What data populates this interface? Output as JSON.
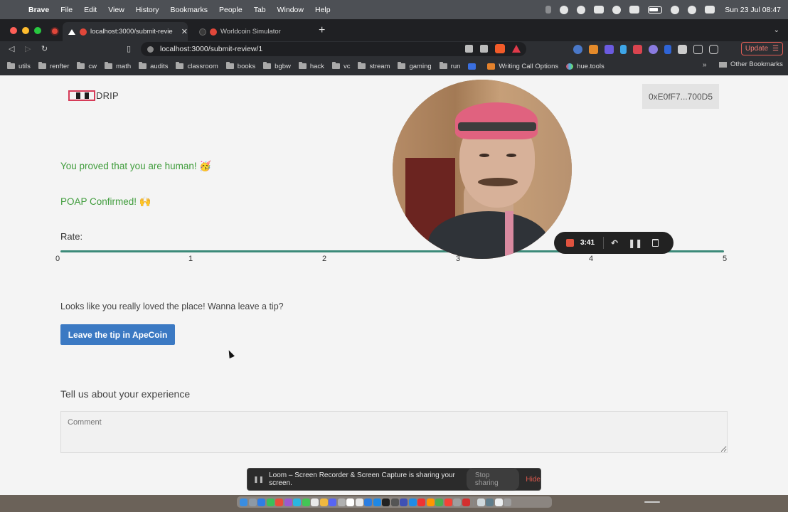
{
  "menubar": {
    "app_name": "Brave",
    "menus": [
      "File",
      "Edit",
      "View",
      "History",
      "Bookmarks",
      "People",
      "Tab",
      "Window",
      "Help"
    ],
    "clock": "Sun 23 Jul  08:47"
  },
  "browser": {
    "tabs": [
      {
        "title": "localhost:3000/submit-revie",
        "active": true
      },
      {
        "title": "Worldcoin Simulator",
        "active": false
      }
    ],
    "url": "localhost:3000/submit-review/1",
    "update_label": "Update",
    "bookmarks": [
      "utils",
      "renfter",
      "cw",
      "math",
      "audits",
      "classroom",
      "books",
      "bgbw",
      "hack",
      "vc",
      "stream",
      "gaming",
      "run"
    ],
    "bookmark_links": [
      "Writing Call Options",
      "hue.tools"
    ],
    "bookmarks_more": "»",
    "other_bookmarks": "Other Bookmarks"
  },
  "page": {
    "logo_text": "DRIP",
    "wallet_address": "0xE0fF7...700D5",
    "human_message": "You proved that you are human! 🥳",
    "poap_message": "POAP Confirmed! 🙌",
    "rate_label": "Rate:",
    "rating_value": 5,
    "rating_ticks": [
      "0",
      "1",
      "2",
      "3",
      "4",
      "5"
    ],
    "tip_prompt": "Looks like you really loved the place! Wanna leave a tip?",
    "tip_button": "Leave the tip in ApeCoin",
    "experience_heading": "Tell us about your experience",
    "comment_placeholder": "Comment"
  },
  "loom": {
    "timer": "3:41",
    "share_notice": "Loom – Screen Recorder & Screen Capture is sharing your screen.",
    "stop_sharing": "Stop sharing",
    "hide": "Hide"
  },
  "colors": {
    "success_text": "#3f9c3b",
    "slider": "#3c8a79",
    "tip_button_bg": "#3b79c3",
    "logo_accent": "#d63b58",
    "loom_record": "#e0533f"
  }
}
